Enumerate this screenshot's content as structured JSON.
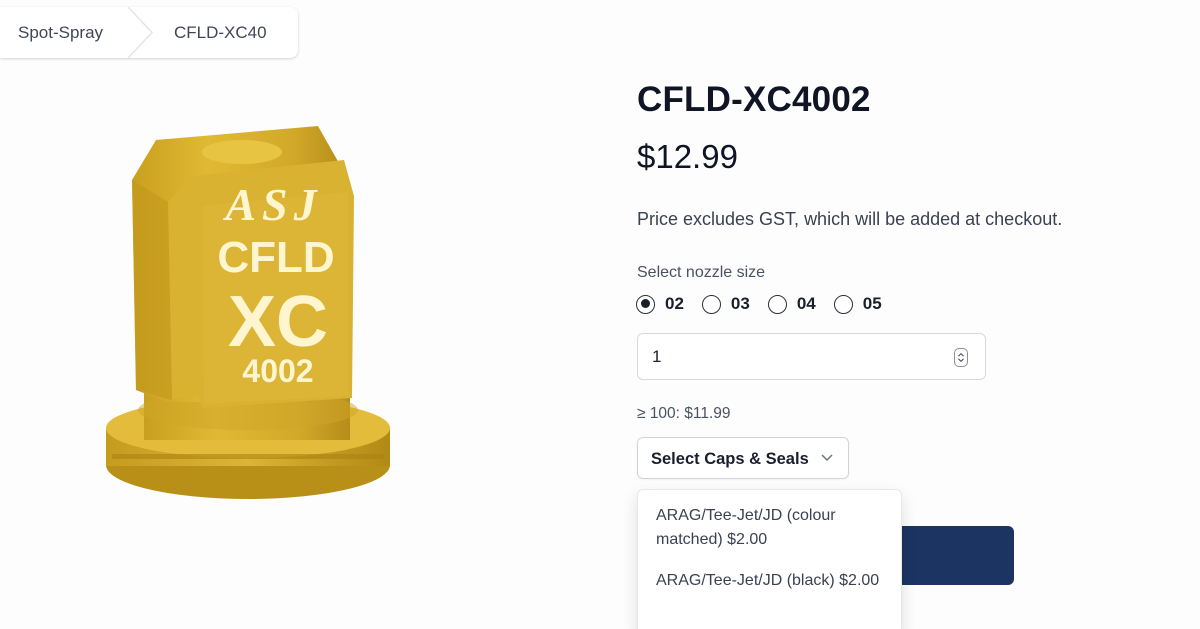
{
  "breadcrumb": {
    "items": [
      "Spot-Spray",
      "CFLD-XC40"
    ]
  },
  "product": {
    "image_text": {
      "brand": "ASJ",
      "line1": "CFLD",
      "line2": "XC",
      "line3": "4002"
    },
    "image_color": "#d8b02a",
    "title": "CFLD-XC4002",
    "price": "$12.99",
    "gst_note": "Price excludes GST, which will be added at checkout.",
    "size_label": "Select nozzle size",
    "sizes": [
      {
        "label": "02",
        "selected": true
      },
      {
        "label": "03",
        "selected": false
      },
      {
        "label": "04",
        "selected": false
      },
      {
        "label": "05",
        "selected": false
      }
    ],
    "quantity": "1",
    "tier_price": "≥ 100: $11.99",
    "caps_select_label": "Select Caps & Seals",
    "caps_options": [
      "ARAG/Tee-Jet/JD (colour matched) $2.00",
      "ARAG/Tee-Jet/JD (black) $2.00"
    ]
  },
  "colors": {
    "accent_button": "#1b3461",
    "text_primary": "#0f1524"
  }
}
